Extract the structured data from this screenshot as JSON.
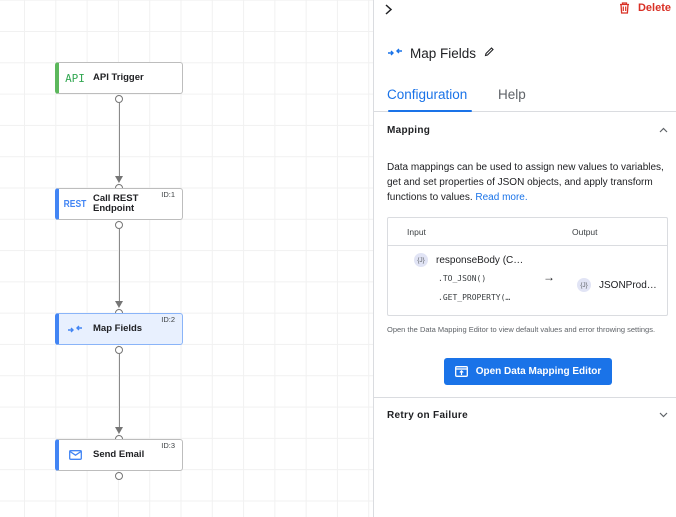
{
  "canvas": {
    "nodes": [
      {
        "label": "API Trigger",
        "icon": "API",
        "icon_name": "api-trigger-icon",
        "id_label": "",
        "kind": "trigger"
      },
      {
        "label": "Call REST Endpoint",
        "icon": "REST",
        "icon_name": "rest-icon",
        "id_label": "ID:1",
        "kind": "task"
      },
      {
        "label": "Map Fields",
        "icon": "map-fields",
        "icon_name": "map-fields-icon",
        "id_label": "ID:2",
        "kind": "task",
        "selected": true
      },
      {
        "label": "Send Email",
        "icon": "mail",
        "icon_name": "mail-icon",
        "id_label": "ID:3",
        "kind": "task"
      }
    ],
    "colors": {
      "trigger": "#34a853",
      "task": "#4285f4",
      "selected_bg": "#e8f0fe"
    }
  },
  "panel": {
    "expand_icon": "chevron-right-icon",
    "delete_label": "Delete",
    "title": "Map Fields",
    "tabs": [
      {
        "label": "Configuration",
        "active": true
      },
      {
        "label": "Help",
        "active": false
      }
    ],
    "mapping": {
      "title": "Mapping",
      "description": "Data mappings can be used to assign new values to variables, get and set properties of JSON objects, and apply transform functions to values.",
      "read_more": "Read more.",
      "table": {
        "input_header": "Input",
        "output_header": "Output",
        "input_badge": "{J}",
        "input_name": "responseBody (C…",
        "functions": [
          ".TO_JSON()",
          ".GET_PROPERTY(…"
        ],
        "arrow": "→",
        "output_badge": "{J}",
        "output_name": "JSONProd…"
      },
      "note": "Open the Data Mapping Editor to view default values and error throwing settings.",
      "open_editor_label": "Open Data Mapping Editor"
    },
    "retry": {
      "title": "Retry on Failure"
    },
    "colors": {
      "accent": "#1a73e8",
      "danger": "#d93025"
    }
  }
}
